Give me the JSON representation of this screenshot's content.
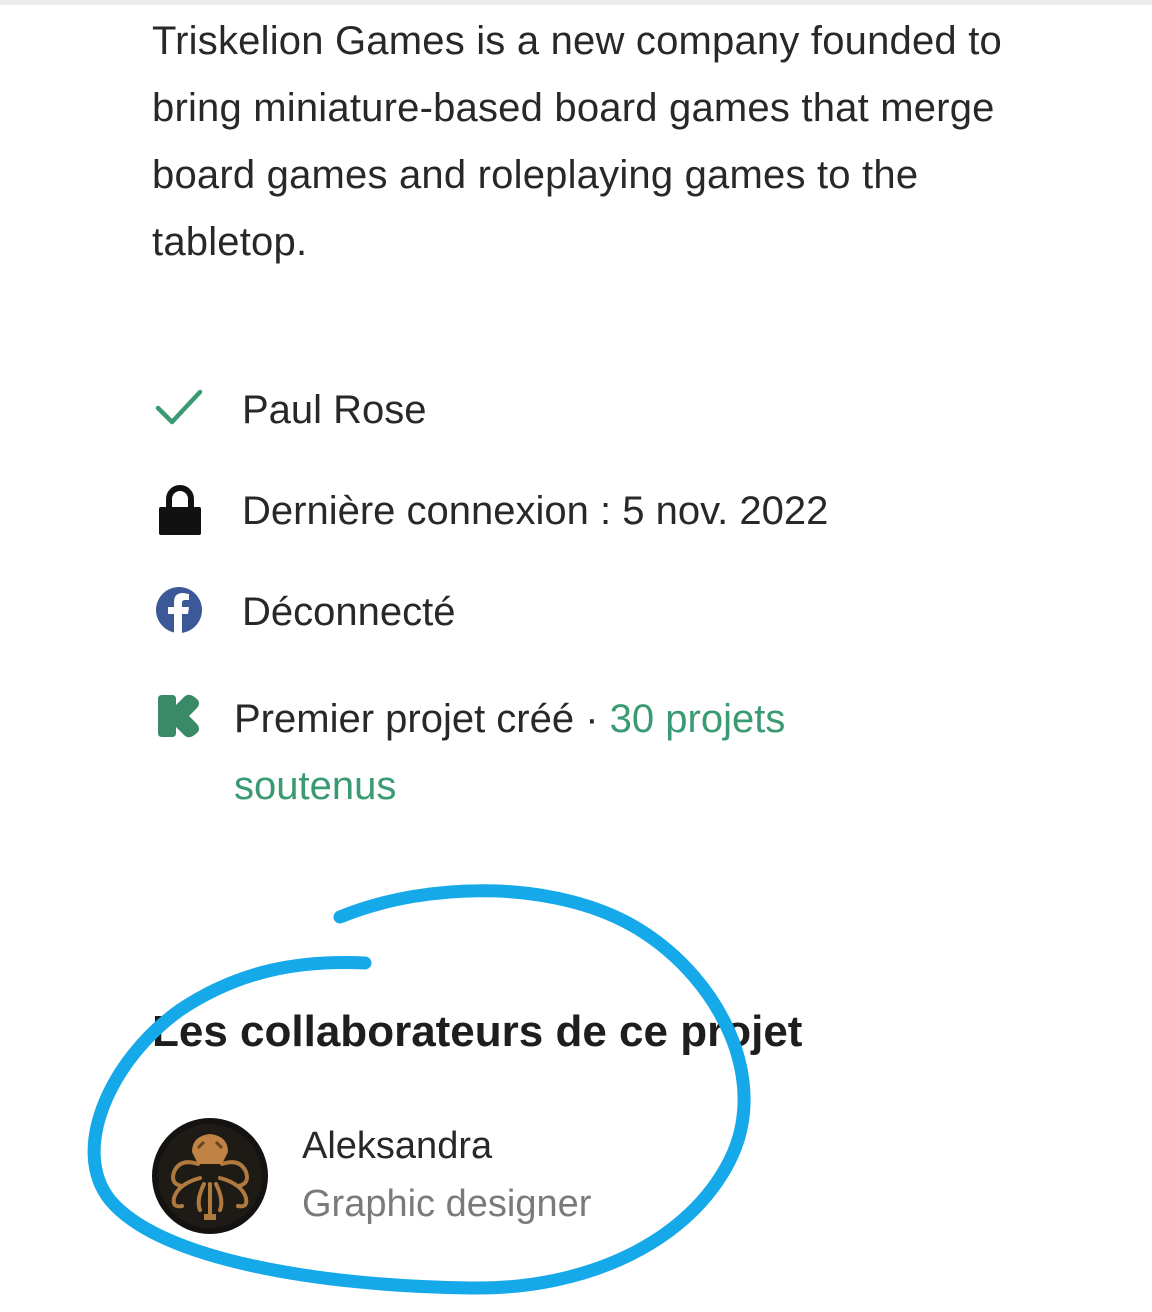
{
  "bio": "Triskelion Games is a new company founded to bring miniature-based board games that merge board games and roleplaying games to the tabletop.",
  "profile": {
    "verified_name": "Paul Rose",
    "last_login": "Dernière connexion : 5 nov. 2022",
    "facebook_status": "Déconnecté",
    "first_project": "Premier projet créé",
    "separator": " · ",
    "backed_projects_link": "30 projets soutenus"
  },
  "collaborators": {
    "title": "Les collaborateurs de ce projet",
    "items": [
      {
        "name": "Aleksandra",
        "role": "Graphic designer"
      }
    ]
  },
  "colors": {
    "accent_green": "#3a9a73",
    "facebook_blue": "#3b5998",
    "annotation_blue": "#15a9ea"
  },
  "icons": [
    "check-icon",
    "lock-icon",
    "facebook-icon",
    "kickstarter-icon"
  ]
}
